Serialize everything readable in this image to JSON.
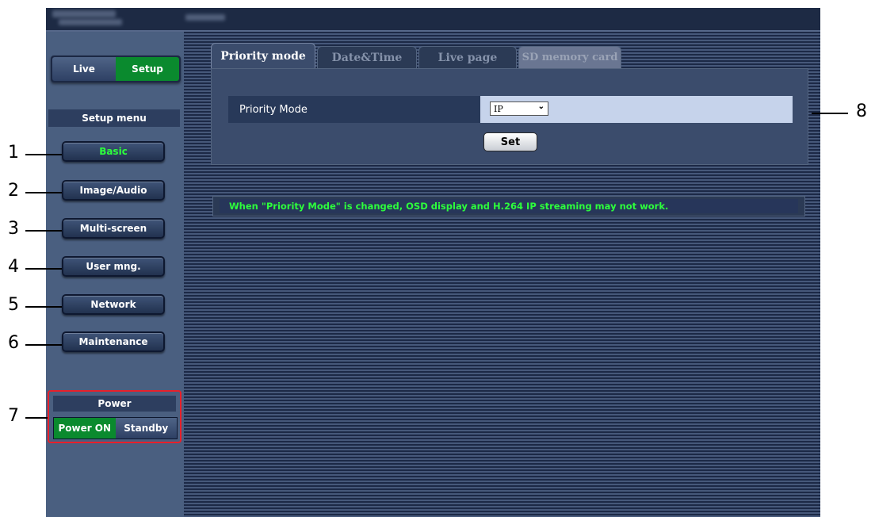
{
  "mode_switch": {
    "live": "Live",
    "setup": "Setup"
  },
  "sidebar": {
    "title": "Setup menu",
    "items": [
      {
        "label": "Basic",
        "active": true
      },
      {
        "label": "Image/Audio"
      },
      {
        "label": "Multi-screen"
      },
      {
        "label": "User mng."
      },
      {
        "label": "Network"
      },
      {
        "label": "Maintenance"
      }
    ]
  },
  "power": {
    "title": "Power",
    "on": "Power ON",
    "standby": "Standby"
  },
  "tabs": [
    "Priority mode",
    "Date&Time",
    "Live page",
    "SD memory card"
  ],
  "form": {
    "label": "Priority Mode",
    "value": "IP",
    "set_button": "Set"
  },
  "notice": "When \"Priority Mode\" is changed, OSD display and H.264 IP streaming may not work.",
  "callouts": [
    "1",
    "2",
    "3",
    "4",
    "5",
    "6",
    "7",
    "8"
  ],
  "colors": {
    "accent_green": "#2dff3c",
    "setup_green": "#0a8a2e",
    "power_border": "#e8202a"
  }
}
